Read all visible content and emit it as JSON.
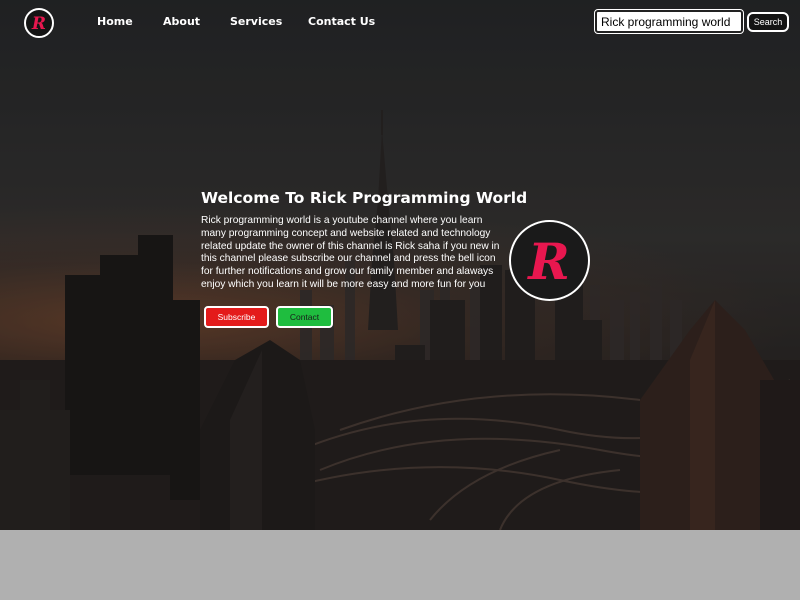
{
  "nav": {
    "logo_icon": "rick-r-logo-icon",
    "links": [
      "Home",
      "About",
      "Services",
      "Contact Us"
    ],
    "search": {
      "value": "Rick programming world",
      "button_label": "Search"
    }
  },
  "hero": {
    "title": "Welcome To Rick Programming World",
    "description": "Rick programming world is a youtube channel where you learn many programming concept and website related and technology related update the owner of this channel is Rick saha if you new in this channel please subscribe our channel and press the bell icon for further notifications and grow our family member and alaways enjoy which you learn it will be more easy and more fun for you",
    "buttons": {
      "subscribe": "Subscribe",
      "contact": "Contact"
    },
    "logo_icon": "rick-r-logo-icon"
  },
  "colors": {
    "accent_red": "#e41b1b",
    "accent_green": "#1fbd3f",
    "logo_red": "#e8174f"
  }
}
